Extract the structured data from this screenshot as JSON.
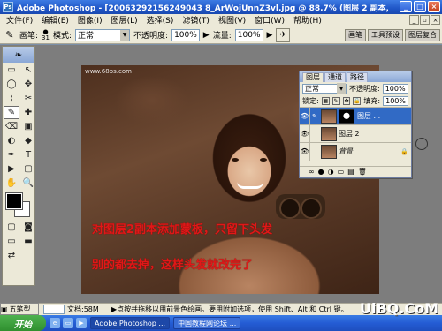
{
  "titlebar": {
    "app_icon_label": "Ps",
    "title": "Adobe Photoshop - [20063292156249043 8_ArWojUnnZ3vl.jpg @ 88.7% (图层 2 副本, 图层蒙版/8)]",
    "minimize": "_",
    "maximize": "□",
    "close": "×"
  },
  "menubar": {
    "items": [
      "文件(F)",
      "编辑(E)",
      "图像(I)",
      "图层(L)",
      "选择(S)",
      "滤镜(T)",
      "视图(V)",
      "窗口(W)",
      "帮助(H)"
    ]
  },
  "optbar": {
    "brush_label": "画笔:",
    "brush_size": "31",
    "mode_label": "模式:",
    "mode_value": "正常",
    "opacity_label": "不透明度:",
    "opacity_value": "100%",
    "flow_label": "流量:",
    "flow_value": "100%",
    "tabs": [
      "画笔",
      "工具预设",
      "图层复合"
    ]
  },
  "toolbox": {
    "tools": [
      "▭",
      "↖",
      "◯",
      "✥",
      "⌇",
      "✂",
      "✎",
      "✚",
      "⌫",
      "▣",
      "◐",
      "◆",
      "✒",
      "T",
      "▶",
      "▢",
      "✋",
      "🔍"
    ]
  },
  "document": {
    "watermark": "www.68ps.com",
    "caption_line1": "对图层2副本添加蒙板，只留下头发",
    "caption_line2": "别的都去掉，这样头发就改完了"
  },
  "layers_panel": {
    "tabs": [
      "图层",
      "通道",
      "路径"
    ],
    "blend_mode": "正常",
    "opacity_label": "不透明度:",
    "opacity_value": "100%",
    "lock_label": "锁定:",
    "fill_label": "填充:",
    "fill_value": "100%",
    "layers": [
      {
        "name": "图层 ...",
        "selected": true
      },
      {
        "name": "图层 2",
        "selected": false
      },
      {
        "name": "背景",
        "selected": false
      }
    ],
    "footer_icons": [
      "∞",
      "●",
      "◑",
      "▭",
      "▤",
      "🗑"
    ]
  },
  "statusbar": {
    "doc_size": "文档:",
    "doc_value": "58M",
    "message": "点按并拖移以用前景色绘画。要用附加选项，使用 Shift、Alt 和 Ctrl 键。"
  },
  "ime": {
    "label": "五笔型"
  },
  "taskbar": {
    "start": "开始",
    "tasks": [
      "Adobe Photoshop ...",
      "中国教程网论坛 ..."
    ]
  },
  "site_mark": "UiBQ.CoM",
  "colors": {
    "caption": "#e01818",
    "selection": "#316ac5",
    "titlebar": "#1f56c7"
  }
}
